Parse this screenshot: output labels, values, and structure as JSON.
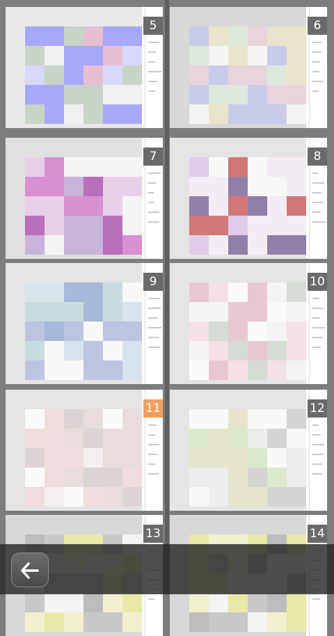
{
  "app": {
    "screen": "document-page-thumbnails"
  },
  "pages": [
    {
      "number": "5",
      "selected": false,
      "palette": [
        "#e8e8e8",
        "#c8d4c8",
        "#e6c0d0",
        "#a8a8f8",
        "#d8d8f8",
        "#f0f0f0"
      ]
    },
    {
      "number": "6",
      "selected": false,
      "palette": [
        "#d8d8d8",
        "#dce8dc",
        "#e8e4cc",
        "#c8cce8",
        "#e8d4dc",
        "#f4f4f4"
      ]
    },
    {
      "number": "7",
      "selected": false,
      "palette": [
        "#e0e0e0",
        "#b870b8",
        "#e8d0e8",
        "#c8b4d8",
        "#d890d0",
        "#f4f4f4"
      ]
    },
    {
      "number": "8",
      "selected": false,
      "palette": [
        "#e4e4e4",
        "#f4ecf4",
        "#d07878",
        "#9080a8",
        "#e0cce8",
        "#f8f8f8"
      ]
    },
    {
      "number": "9",
      "selected": false,
      "palette": [
        "#e4e4e4",
        "#c8dce0",
        "#a8b8d8",
        "#bcc4e0",
        "#d8e4ec",
        "#f8f8f8"
      ]
    },
    {
      "number": "10",
      "selected": false,
      "palette": [
        "#e4e4e4",
        "#f4e0e4",
        "#d4dcd4",
        "#e8c8d0",
        "#f4f4f4",
        "#fafafa"
      ]
    },
    {
      "number": "11",
      "selected": true,
      "palette": [
        "#e4e4e4",
        "#f0dcdc",
        "#dcd4d4",
        "#e8dcdc",
        "#f4eeee",
        "#fafafa"
      ]
    },
    {
      "number": "12",
      "selected": false,
      "palette": [
        "#e4e4e4",
        "#dce8cc",
        "#e4e4cc",
        "#d4d4d4",
        "#ececec",
        "#f8f8f8"
      ]
    },
    {
      "number": "13",
      "selected": false,
      "palette": [
        "#d8d8d8",
        "#e8e8a8",
        "#c8c8c8",
        "#f0f0d0",
        "#bcbcbc",
        "#f4f4f4"
      ]
    },
    {
      "number": "14",
      "selected": false,
      "palette": [
        "#d8d8d8",
        "#e8e8a8",
        "#c8c8c8",
        "#f0f0d0",
        "#bcbcbc",
        "#f4f4f4"
      ]
    }
  ],
  "bottom_bar": {
    "back_icon": "back-arrow-icon"
  }
}
